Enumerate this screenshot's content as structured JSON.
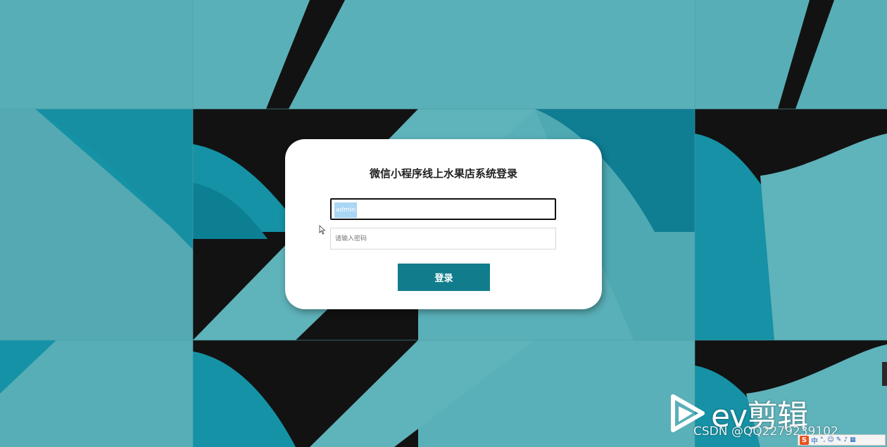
{
  "login": {
    "title": "微信小程序线上水果店系统登录",
    "username_value": "admin",
    "password_placeholder": "请输入密码",
    "submit_label": "登录"
  },
  "watermark": {
    "app_name": "ev剪辑",
    "credit": "CSDN @QQ2279239102"
  },
  "ime": {
    "logo": "S",
    "mode": "中"
  },
  "colors": {
    "accent": "#117d8c",
    "background_teal": "#5ab0b8",
    "background_dark": "#121212"
  }
}
